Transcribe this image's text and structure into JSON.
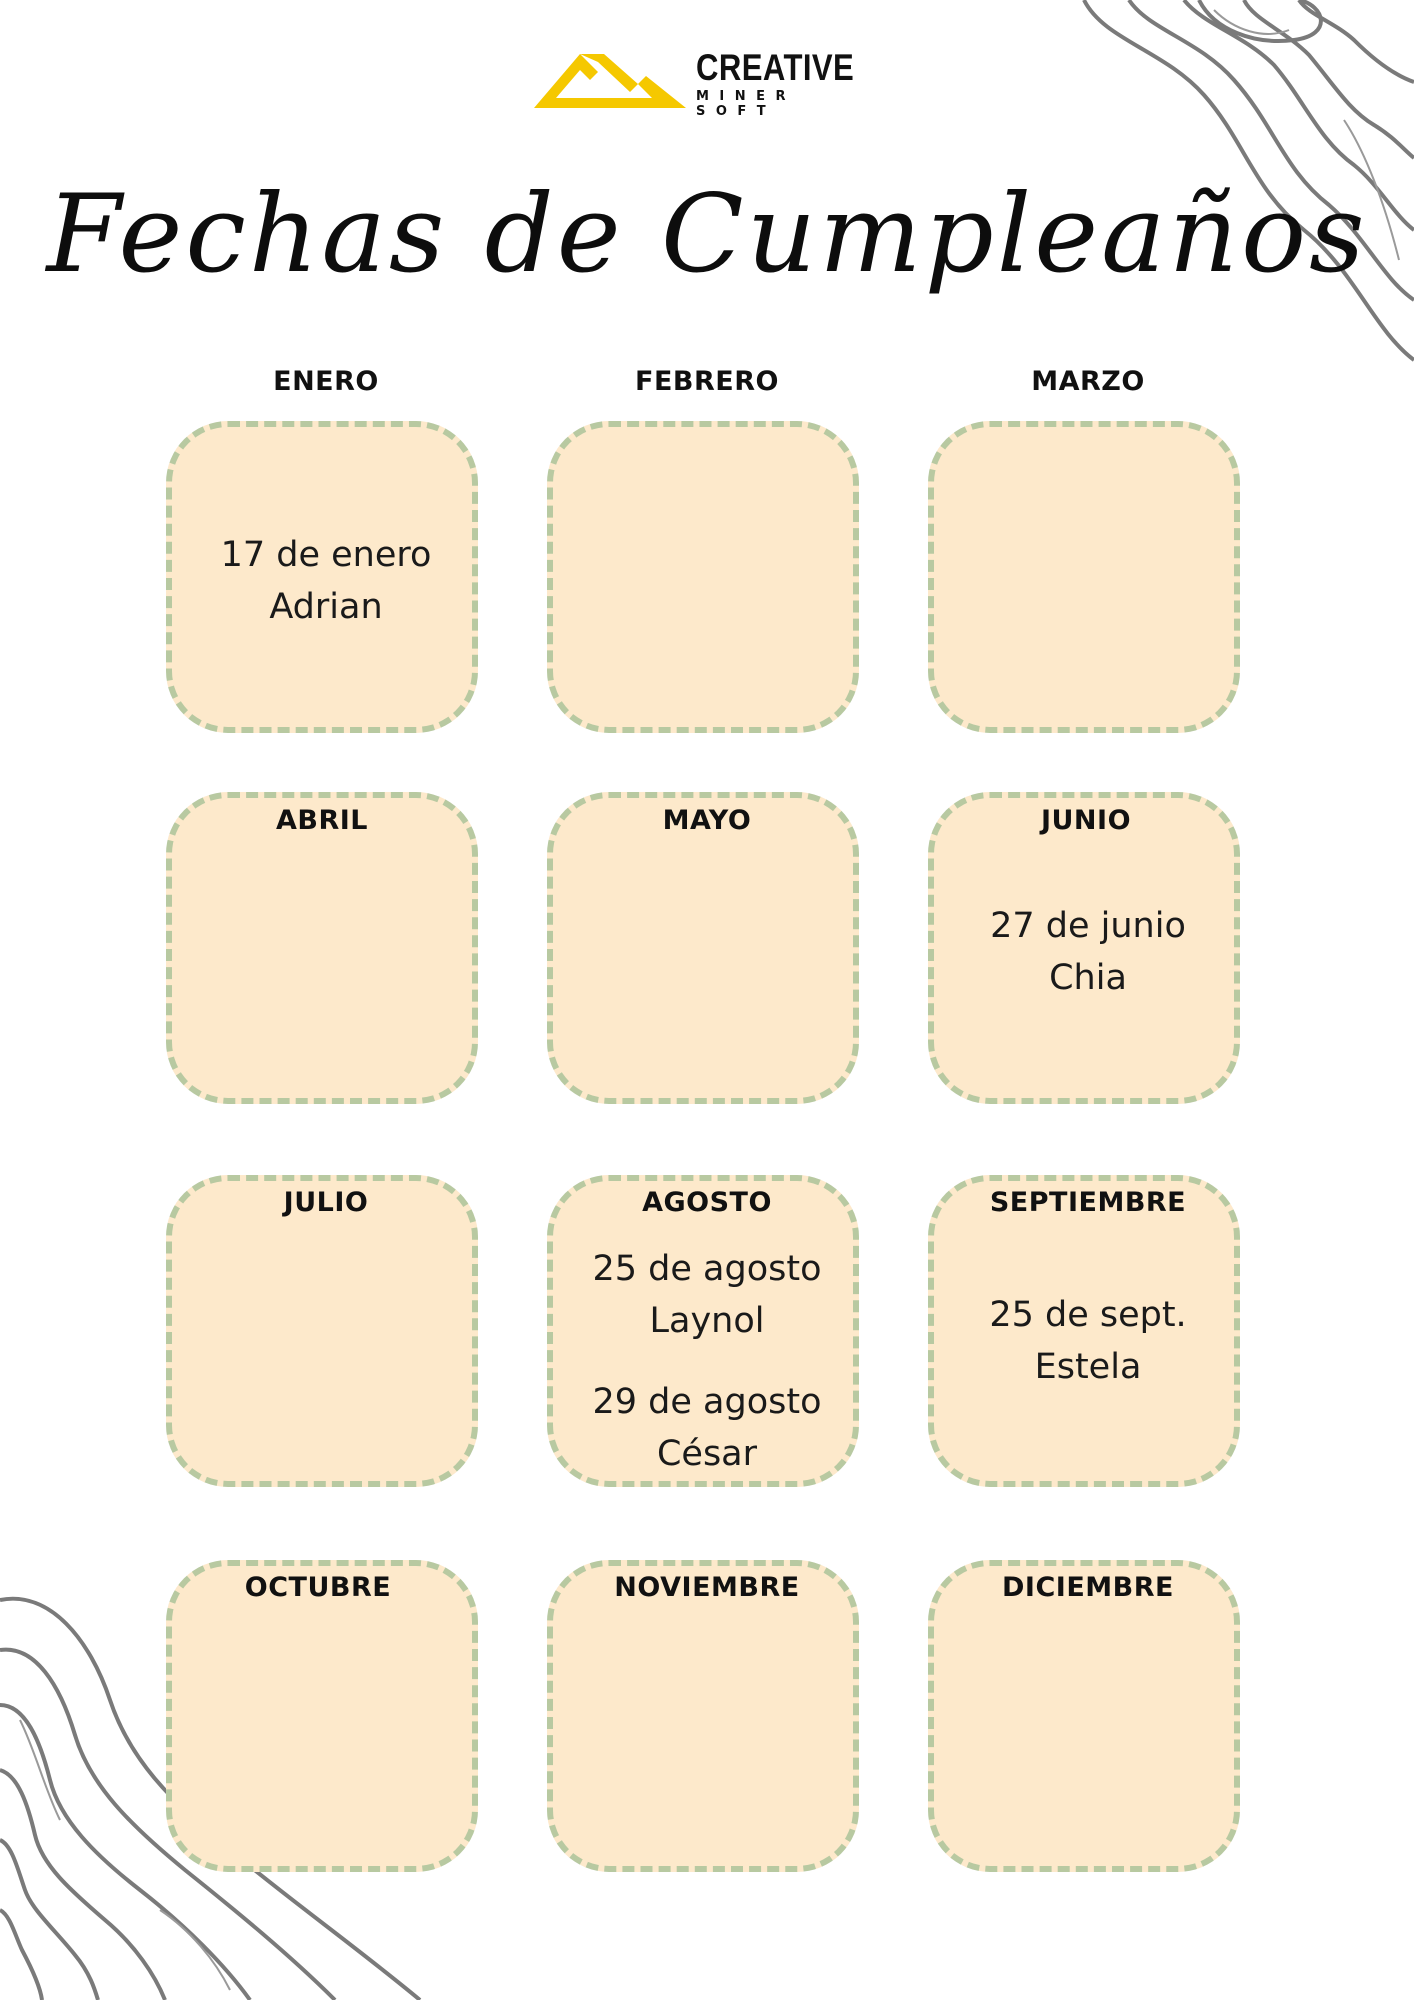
{
  "logo": {
    "name": "CREATIVE",
    "subtitle": "MINER SOFT",
    "brand_color": "#f5c800"
  },
  "title": "Fechas de Cumpleaños",
  "colors": {
    "box_fill": "#fde9cb",
    "box_border": "#b8c9a1",
    "deco_lines": "#7a7a7a"
  },
  "months": [
    {
      "name": "ENERO",
      "entries": [
        {
          "date": "17  de enero",
          "person": "Adrian"
        }
      ]
    },
    {
      "name": "FEBRERO",
      "entries": []
    },
    {
      "name": "MARZO",
      "entries": []
    },
    {
      "name": "ABRIL",
      "entries": []
    },
    {
      "name": "MAYO",
      "entries": []
    },
    {
      "name": "JUNIO",
      "entries": [
        {
          "date": "27 de junio",
          "person": "Chia"
        }
      ]
    },
    {
      "name": "JULIO",
      "entries": []
    },
    {
      "name": "AGOSTO",
      "entries": [
        {
          "date": "25 de agosto",
          "person": "Laynol"
        },
        {
          "date": "29 de agosto",
          "person": "César"
        }
      ]
    },
    {
      "name": "SEPTIEMBRE",
      "entries": [
        {
          "date": "25 de sept.",
          "person": "Estela"
        }
      ]
    },
    {
      "name": "OCTUBRE",
      "entries": []
    },
    {
      "name": "NOVIEMBRE",
      "entries": []
    },
    {
      "name": "DICIEMBRE",
      "entries": []
    }
  ]
}
